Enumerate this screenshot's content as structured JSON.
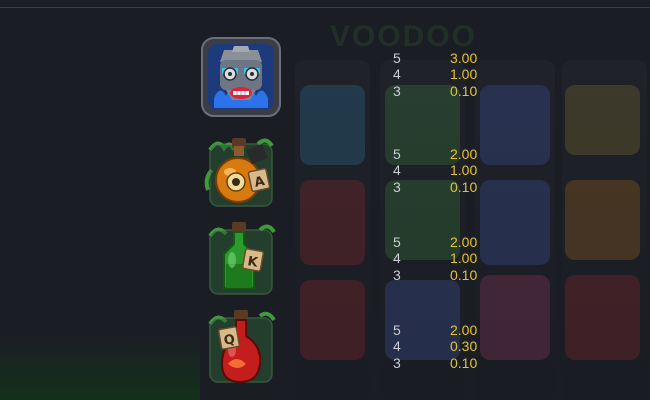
{
  "ghost_title": "VOODOO",
  "paytable": [
    {
      "symbol": "voodoo-mask-icon",
      "pays": [
        {
          "count": "5",
          "value": "3.00"
        },
        {
          "count": "4",
          "value": "1.00"
        },
        {
          "count": "3",
          "value": "0.10"
        }
      ]
    },
    {
      "symbol": "potion-a-icon",
      "pays": [
        {
          "count": "5",
          "value": "2.00"
        },
        {
          "count": "4",
          "value": "1.00"
        },
        {
          "count": "3",
          "value": "0.10"
        }
      ]
    },
    {
      "symbol": "potion-k-icon",
      "pays": [
        {
          "count": "5",
          "value": "2.00"
        },
        {
          "count": "4",
          "value": "1.00"
        },
        {
          "count": "3",
          "value": "0.10"
        }
      ]
    },
    {
      "symbol": "potion-q-icon",
      "pays": [
        {
          "count": "5",
          "value": "2.00"
        },
        {
          "count": "4",
          "value": "0.30"
        },
        {
          "count": "3",
          "value": "0.10"
        }
      ]
    }
  ],
  "colors": {
    "count_text": "#c9ccd3",
    "value_text": "#e4c234",
    "background": "#1b1d24"
  }
}
